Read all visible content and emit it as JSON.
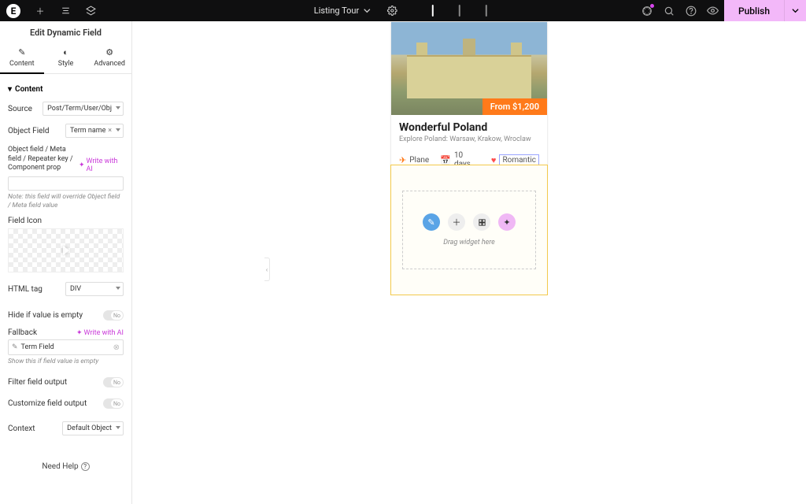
{
  "topbar": {
    "doc_name": "Listing Tour",
    "publish_label": "Publish"
  },
  "panel": {
    "title": "Edit Dynamic Field",
    "tabs": {
      "content": "Content",
      "style": "Style",
      "advanced": "Advanced"
    },
    "section_content": "Content",
    "source_label": "Source",
    "source_value": "Post/Term/User/Obj",
    "object_field_label": "Object Field",
    "object_field_value": "Term name",
    "meta_field_label": "Object field / Meta field / Repeater key / Component prop",
    "ai_link": "Write with AI",
    "meta_note": "Note: this field will override Object field / Meta field value",
    "field_icon_label": "Field Icon",
    "html_tag_label": "HTML tag",
    "html_tag_value": "DIV",
    "hide_empty_label": "Hide if value is empty",
    "fallback_label": "Fallback",
    "fallback_value": "Term Field",
    "fallback_note": "Show this if field value is empty",
    "filter_output_label": "Filter field output",
    "customize_output_label": "Customize field output",
    "context_label": "Context",
    "context_value": "Default Object",
    "toggle_no": "No",
    "need_help": "Need Help"
  },
  "card": {
    "price": "From $1,200",
    "title": "Wonderful Poland",
    "subtitle": "Explore Poland: Warsaw, Krakow, Wroclaw",
    "meta_transport": "Plane",
    "meta_duration": "10 days",
    "meta_category": "Romantic"
  },
  "drop": {
    "label": "Drag widget here"
  }
}
